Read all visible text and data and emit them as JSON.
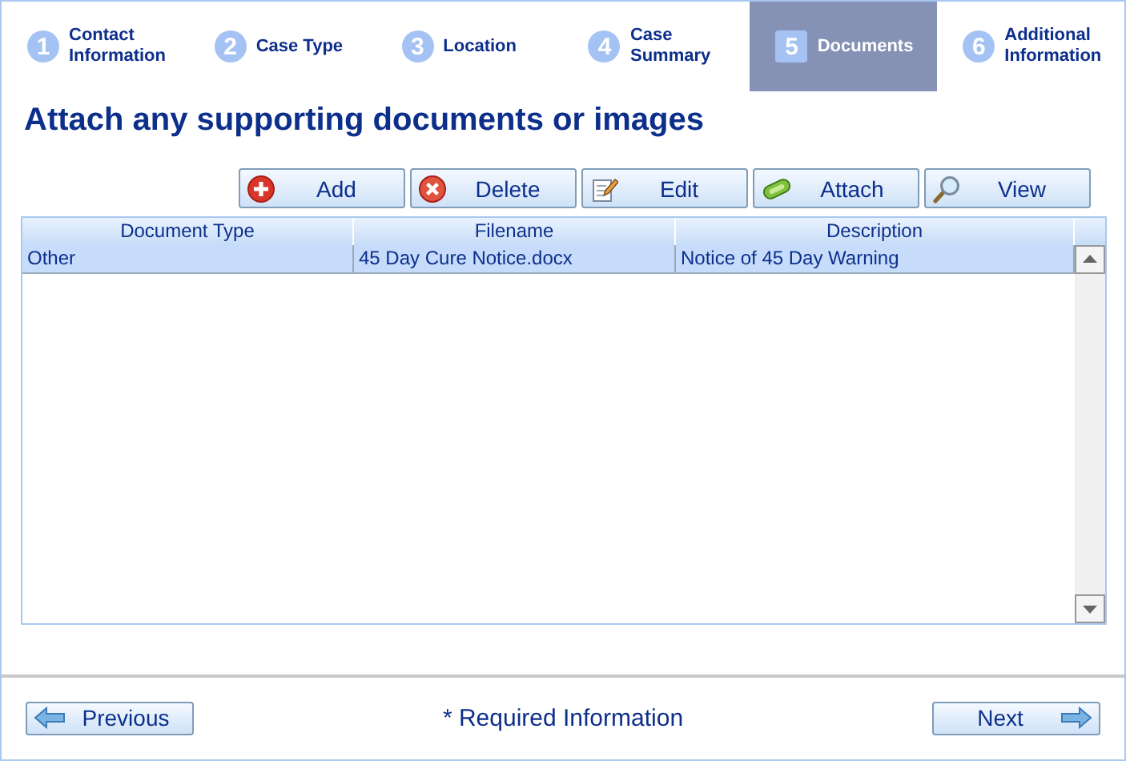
{
  "steps": [
    {
      "number": "1",
      "label": "Contact Information",
      "selected": false
    },
    {
      "number": "2",
      "label": "Case Type",
      "selected": false
    },
    {
      "number": "3",
      "label": "Location",
      "selected": false
    },
    {
      "number": "4",
      "label": "Case Summary",
      "selected": false
    },
    {
      "number": "5",
      "label": "Documents",
      "selected": true
    },
    {
      "number": "6",
      "label": "Additional Information",
      "selected": false
    }
  ],
  "heading": "Attach any supporting documents or images",
  "toolbar": [
    {
      "kind": "add",
      "label": "Add"
    },
    {
      "kind": "delete",
      "label": "Delete"
    },
    {
      "kind": "edit",
      "label": "Edit"
    },
    {
      "kind": "attach",
      "label": "Attach"
    },
    {
      "kind": "view",
      "label": "View"
    }
  ],
  "table": {
    "columns": [
      "Document Type",
      "Filename",
      "Description"
    ],
    "rows": [
      {
        "cells": [
          "Other",
          "45 Day Cure Notice.docx",
          "Notice of 45 Day Warning"
        ],
        "selected": true
      }
    ]
  },
  "footer": {
    "previous": "Previous",
    "required_note": "* Required Information",
    "next": "Next"
  }
}
